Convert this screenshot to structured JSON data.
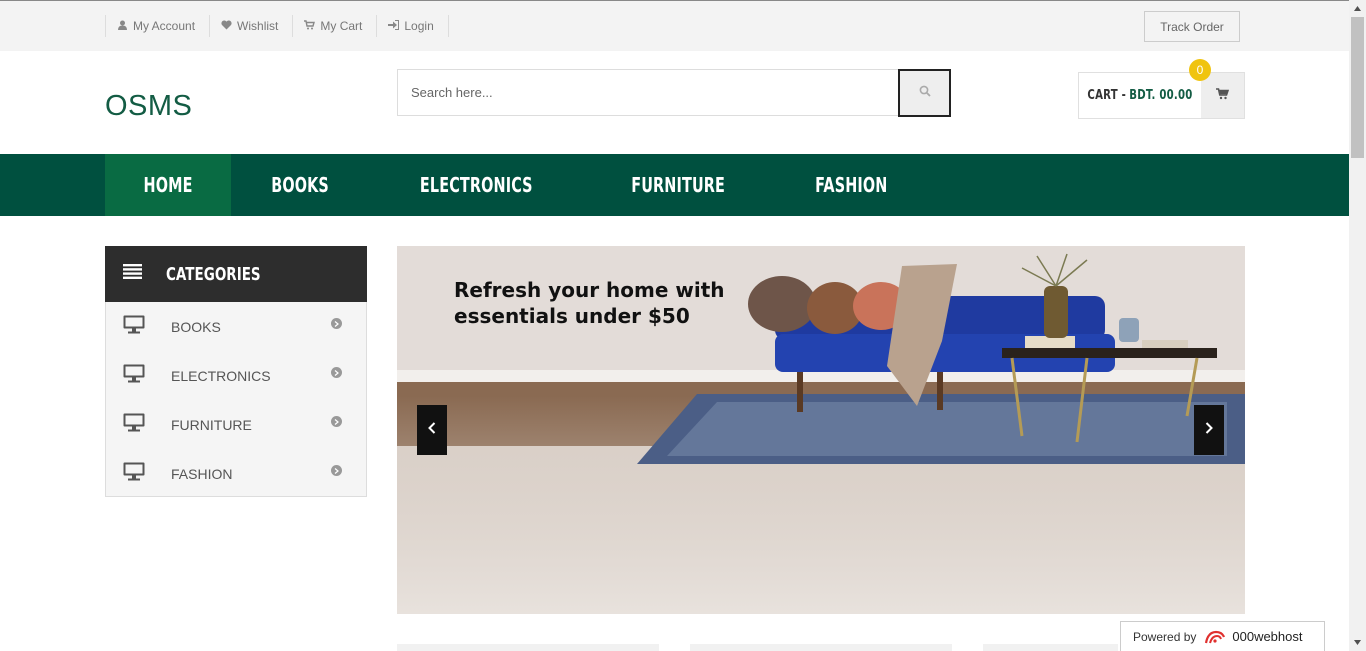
{
  "topbar": {
    "links": [
      {
        "label": "My Account",
        "icon": "user-icon"
      },
      {
        "label": "Wishlist",
        "icon": "heart-icon"
      },
      {
        "label": "My Cart",
        "icon": "cart-icon"
      },
      {
        "label": "Login",
        "icon": "login-icon"
      }
    ],
    "track_order_label": "Track Order"
  },
  "header": {
    "logo": "OSMS",
    "search": {
      "placeholder": "Search here...",
      "value": ""
    },
    "cart": {
      "label": "CART -",
      "amount": "BDT. 00.00",
      "count": "0"
    }
  },
  "nav": {
    "items": [
      "HOME",
      "BOOKS",
      "ELECTRONICS",
      "FURNITURE",
      "FASHION"
    ],
    "active": "HOME"
  },
  "categories": {
    "title": "CATEGORIES",
    "items": [
      "BOOKS",
      "ELECTRONICS",
      "FURNITURE",
      "FASHION"
    ],
    "item_icon": "monitor-icon"
  },
  "banner": {
    "headline_line1": "Refresh your home with",
    "headline_line2": "essentials under $50"
  },
  "footer_badge": {
    "label": "Powered by",
    "brand": "000webhost"
  },
  "colors": {
    "brand_green": "#00503f",
    "active_green": "#096b43",
    "logo_green": "#135c44",
    "badge_yellow": "#f0c40f"
  }
}
